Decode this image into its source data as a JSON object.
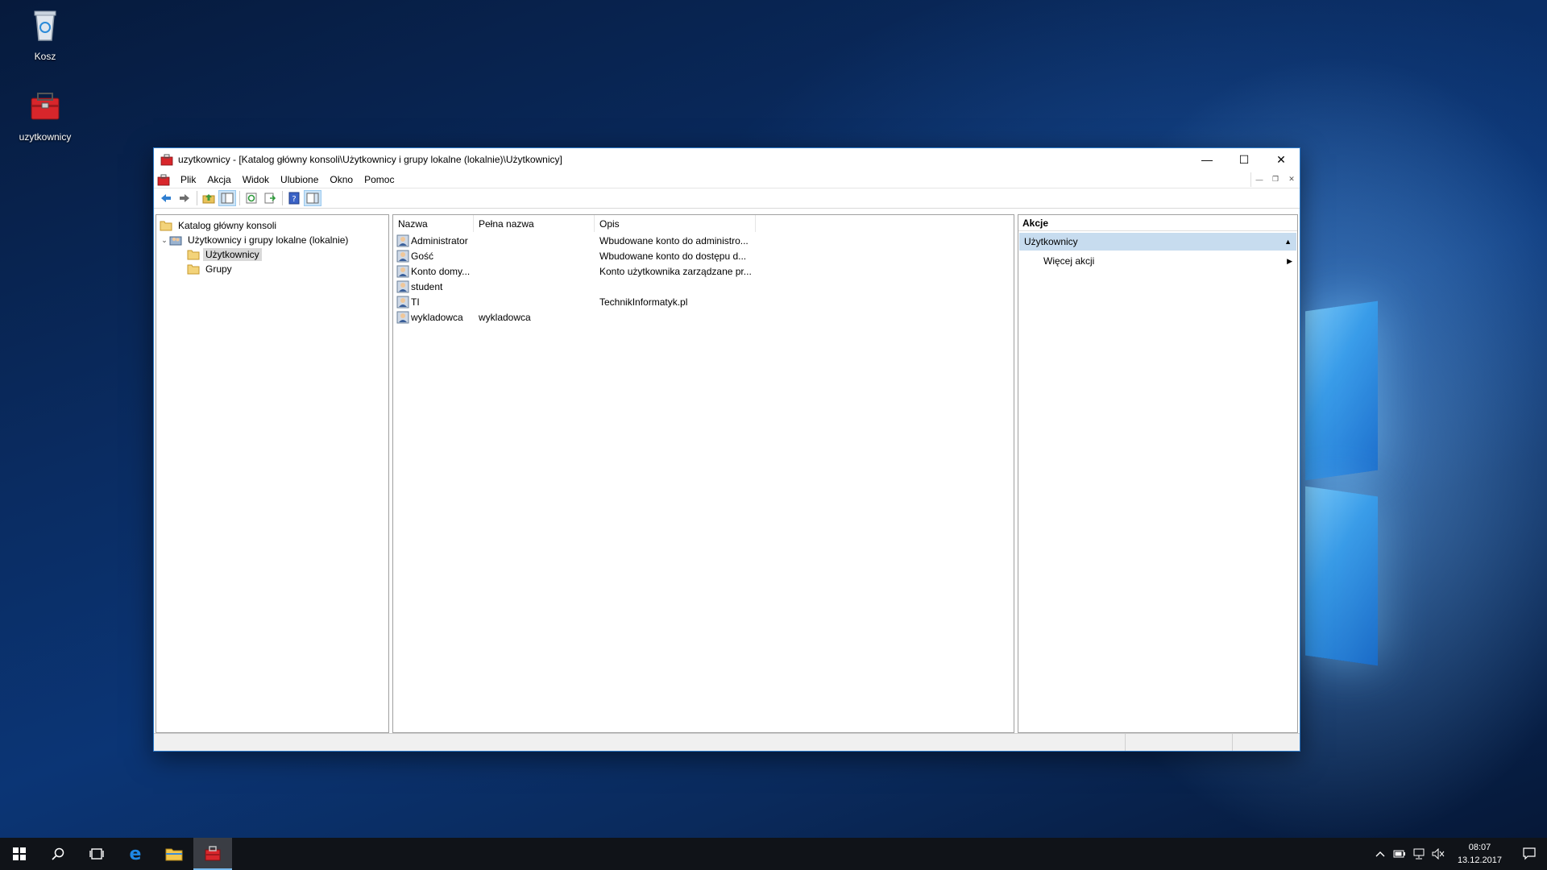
{
  "desktop": {
    "icons": [
      {
        "label": "Kosz"
      },
      {
        "label": "uzytkownicy"
      }
    ]
  },
  "window": {
    "title": "uzytkownicy - [Katalog główny konsoli\\Użytkownicy i grupy lokalne (lokalnie)\\Użytkownicy]",
    "menu": [
      "Plik",
      "Akcja",
      "Widok",
      "Ulubione",
      "Okno",
      "Pomoc"
    ],
    "tree": {
      "root": "Katalog główny konsoli",
      "group": "Użytkownicy i grupy lokalne (lokalnie)",
      "items": [
        "Użytkownicy",
        "Grupy"
      ]
    },
    "list": {
      "headers": [
        "Nazwa",
        "Pełna nazwa",
        "Opis"
      ],
      "rows": [
        {
          "name": "Administrator",
          "full_name": "",
          "desc": "Wbudowane konto do administro..."
        },
        {
          "name": "Gość",
          "full_name": "",
          "desc": "Wbudowane konto do dostępu d..."
        },
        {
          "name": "Konto domy...",
          "full_name": "",
          "desc": "Konto użytkownika zarządzane pr..."
        },
        {
          "name": "student",
          "full_name": "",
          "desc": ""
        },
        {
          "name": "TI",
          "full_name": "",
          "desc": "TechnikInformatyk.pl"
        },
        {
          "name": "wykladowca",
          "full_name": "wykladowca",
          "desc": ""
        }
      ]
    },
    "actions": {
      "header": "Akcje",
      "section": "Użytkownicy",
      "item": "Więcej akcji"
    }
  },
  "taskbar": {
    "time": "08:07",
    "date": "13.12.2017"
  },
  "colors": {
    "accent": "#2b79c8",
    "selection": "#c7dcef",
    "taskbar": "#101318"
  }
}
